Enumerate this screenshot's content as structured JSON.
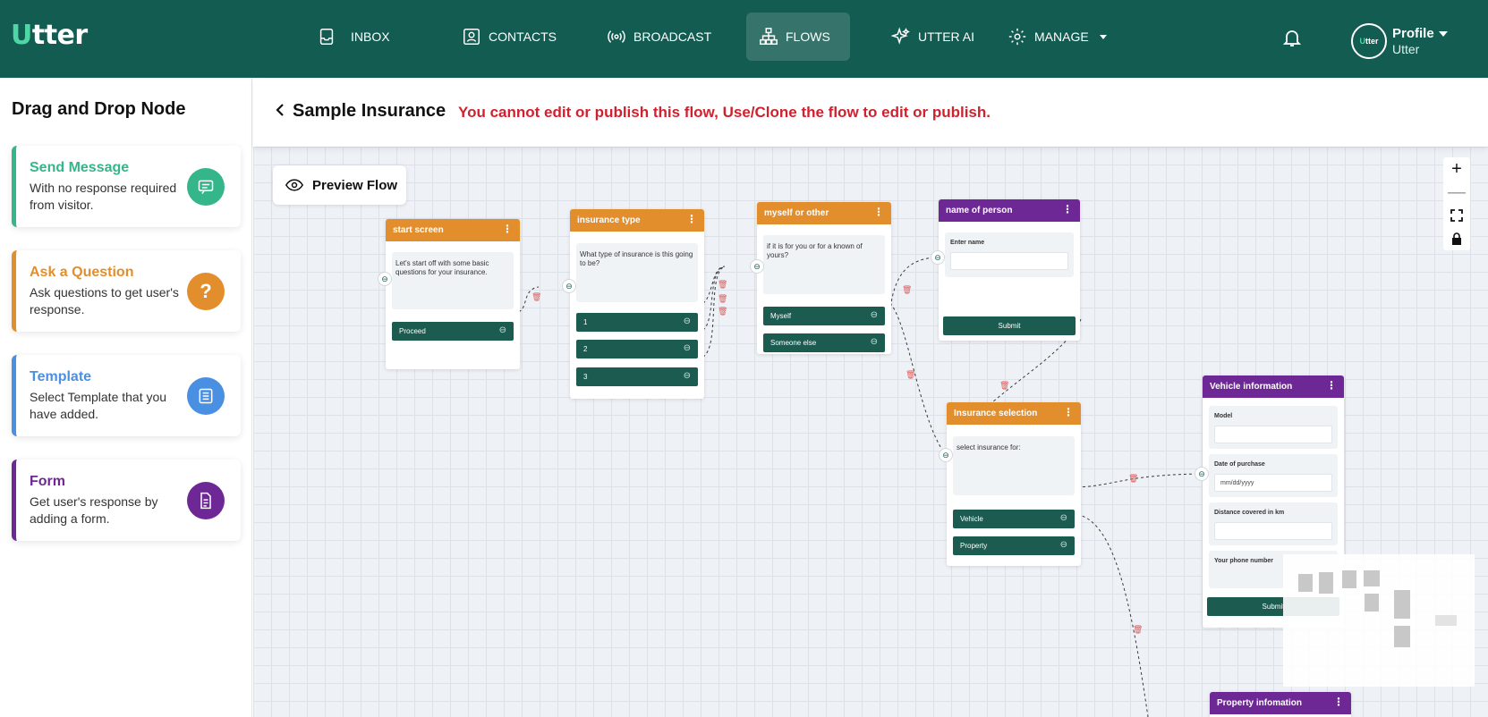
{
  "brand": {
    "logo_prefix": "U",
    "logo_rest": "tter"
  },
  "nav": {
    "inbox": "INBOX",
    "contacts": "CONTACTS",
    "broadcast": "BROADCAST",
    "flows": "FLOWS",
    "utter_ai": "UTTER AI",
    "manage": "MANAGE"
  },
  "profile": {
    "avatar_prefix": "U",
    "avatar_rest": "tter",
    "name": "Profile",
    "sub": "Utter"
  },
  "sidebar": {
    "title": "Drag and Drop Node",
    "items": [
      {
        "title": "Send Message",
        "desc": "With no response required from visitor.",
        "color": "#35b58a",
        "icon": "message-icon"
      },
      {
        "title": "Ask a Question",
        "desc": "Ask questions to get user's response.",
        "color": "#e28e2d",
        "icon": "question-icon",
        "icon_glyph": "?"
      },
      {
        "title": "Template",
        "desc": "Select Template that you have added.",
        "color": "#4a90e2",
        "icon": "template-icon"
      },
      {
        "title": "Form",
        "desc": "Get user's response by adding a form.",
        "color": "#6e2896",
        "icon": "form-icon"
      }
    ]
  },
  "header": {
    "flow_title": "Sample Insurance",
    "warning": "You cannot edit or publish this flow, Use/Clone the flow to edit or publish."
  },
  "canvas": {
    "preview_label": "Preview Flow",
    "zoom": {
      "plus": "+",
      "minus": "—"
    },
    "nodes": {
      "start_screen": {
        "title": "start screen",
        "body": "Let's start off with some basic questions for your insurance.",
        "options": [
          "Proceed"
        ]
      },
      "insurance_type": {
        "title": "insurance type",
        "body": "What type of insurance is this going to be?",
        "options": [
          "1",
          "2",
          "3"
        ]
      },
      "myself_or_other": {
        "title": "myself or other",
        "body": "if it is for you or for a known of yours?",
        "options": [
          "Myself",
          "Someone else"
        ]
      },
      "name_of_person": {
        "title": "name of person",
        "field_label": "Enter name",
        "submit": "Submit"
      },
      "insurance_selection": {
        "title": "Insurance selection",
        "body": "select insurance for:",
        "options": [
          "Vehicle",
          "Property"
        ]
      },
      "vehicle_information": {
        "title": "Vehicle information",
        "fields": [
          "Model",
          "Date of purchase",
          "Distance covered in km",
          "Your phone number"
        ],
        "date_placeholder": "mm/dd/yyyy",
        "submit": "Submit"
      },
      "property_information": {
        "title": "Property infomation"
      }
    }
  },
  "colors": {
    "topbar": "#135c52",
    "orange": "#e28e2d",
    "purple": "#6e2896",
    "button": "#1b5b50",
    "warning": "#d0212f"
  }
}
